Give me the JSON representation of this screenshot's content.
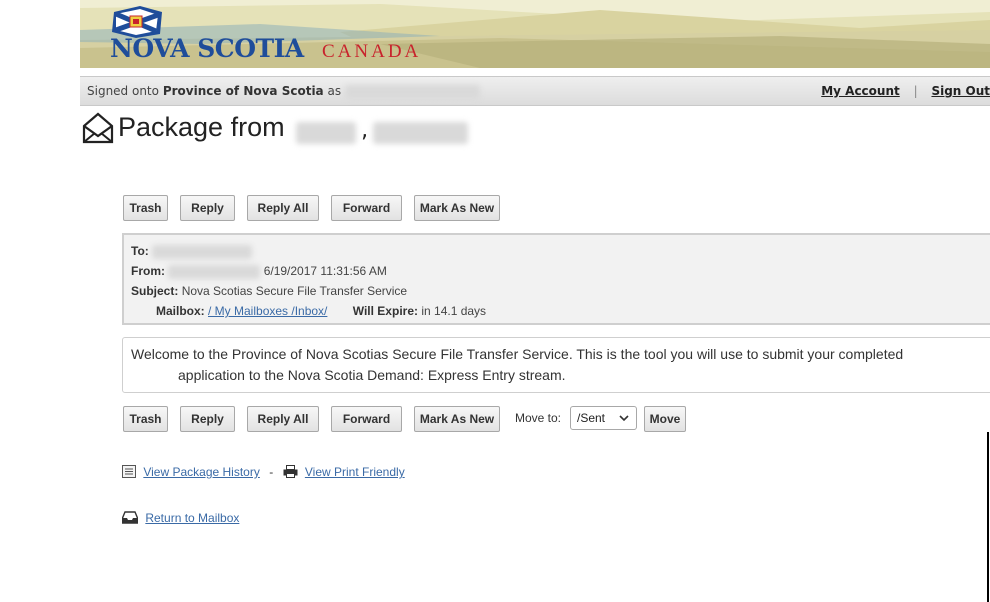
{
  "header": {
    "logo_main": "NOVA SCOTIA",
    "logo_sub": "CANADA"
  },
  "signbar": {
    "signed_prefix": "Signed onto",
    "org": "Province of Nova Scotia",
    "as_text": "as",
    "my_account": "My Account",
    "separator": "|",
    "sign_out": "Sign Out"
  },
  "page": {
    "title": "Package from",
    "title_punct": ","
  },
  "toolbar": {
    "trash": "Trash",
    "reply": "Reply",
    "reply_all": "Reply All",
    "forward": "Forward",
    "mark_new": "Mark As New"
  },
  "details": {
    "to_label": "To:",
    "from_label": "From:",
    "from_value": "6/19/2017 11:31:56 AM",
    "subject_label": "Subject:",
    "subject_value": "Nova Scotias Secure File Transfer Service",
    "mailbox_label": "Mailbox:",
    "mailbox_value": "/ My Mailboxes /Inbox/",
    "expire_label": "Will Expire:",
    "expire_value": "in 14.1 days"
  },
  "message": {
    "line1": "Welcome to the Province of Nova Scotias Secure File Transfer Service.  This is the tool you will use to submit your completed",
    "line2": "application to the Nova Scotia Demand:  Express Entry stream."
  },
  "move": {
    "label": "Move to:",
    "selected": "/Sent",
    "button": "Move"
  },
  "links": {
    "history": "View Package History",
    "dash": "-",
    "print": "View Print Friendly",
    "return": "Return to Mailbox"
  },
  "icons": {
    "envelope": "envelope-open-icon",
    "history": "list-icon",
    "print": "printer-icon",
    "return": "inbox-tray-icon"
  },
  "colors": {
    "logo_blue": "#1f4d9a",
    "logo_red": "#c8232c",
    "link": "#3a6aa6"
  }
}
